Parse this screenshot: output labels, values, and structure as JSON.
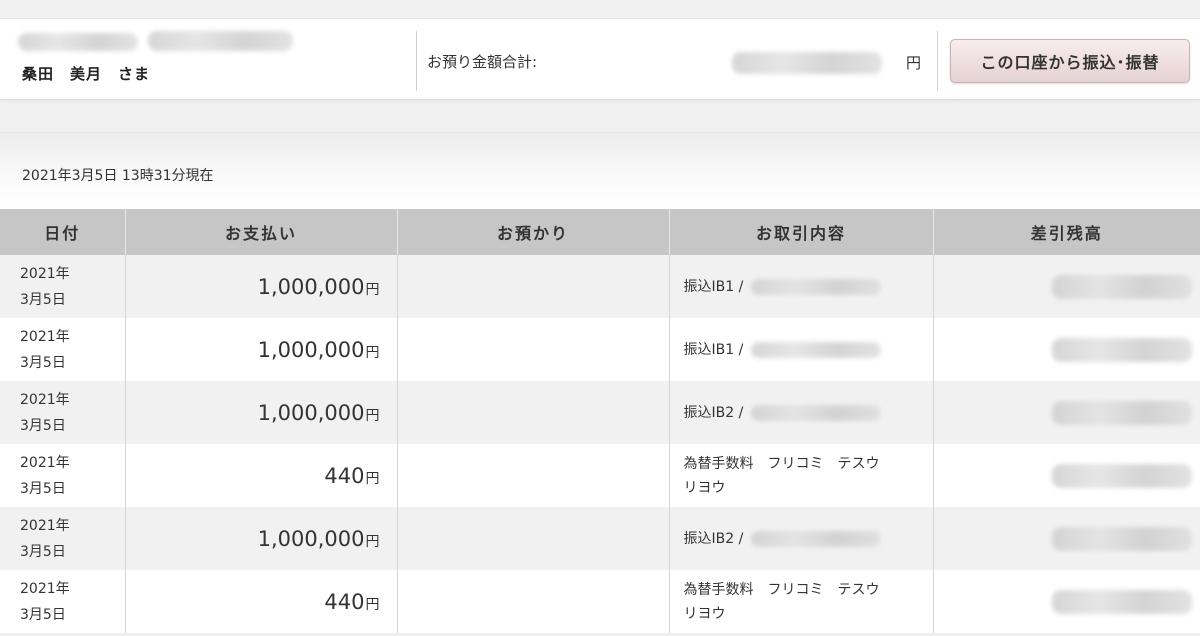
{
  "header": {
    "holder_name": "桑田　美月　さま",
    "deposit_total_label": "お預り金額合計:",
    "yen_unit": "円",
    "transfer_button_label": "この口座から振込･振替"
  },
  "statement": {
    "as_of": "2021年3月5日  13時31分現在",
    "columns": [
      "日付",
      "お支払い",
      "お預かり",
      "お取引内容",
      "差引残高"
    ],
    "rows": [
      {
        "date_year": "2021年",
        "date_day": "3月5日",
        "payment": "1,000,000",
        "payment_unit": "円",
        "deposit": "",
        "desc_line1": "振込IB1 /",
        "desc_line2": ""
      },
      {
        "date_year": "2021年",
        "date_day": "3月5日",
        "payment": "1,000,000",
        "payment_unit": "円",
        "deposit": "",
        "desc_line1": "振込IB1 /",
        "desc_line2": ""
      },
      {
        "date_year": "2021年",
        "date_day": "3月5日",
        "payment": "1,000,000",
        "payment_unit": "円",
        "deposit": "",
        "desc_line1": "振込IB2 /",
        "desc_line2": ""
      },
      {
        "date_year": "2021年",
        "date_day": "3月5日",
        "payment": "440",
        "payment_unit": "円",
        "deposit": "",
        "desc_line1": "為替手数料　フリコミ　テスウ",
        "desc_line2": "リヨウ"
      },
      {
        "date_year": "2021年",
        "date_day": "3月5日",
        "payment": "1,000,000",
        "payment_unit": "円",
        "deposit": "",
        "desc_line1": "振込IB2 /",
        "desc_line2": ""
      },
      {
        "date_year": "2021年",
        "date_day": "3月5日",
        "payment": "440",
        "payment_unit": "円",
        "deposit": "",
        "desc_line1": "為替手数料　フリコミ　テスウ",
        "desc_line2": "リヨウ"
      }
    ]
  }
}
